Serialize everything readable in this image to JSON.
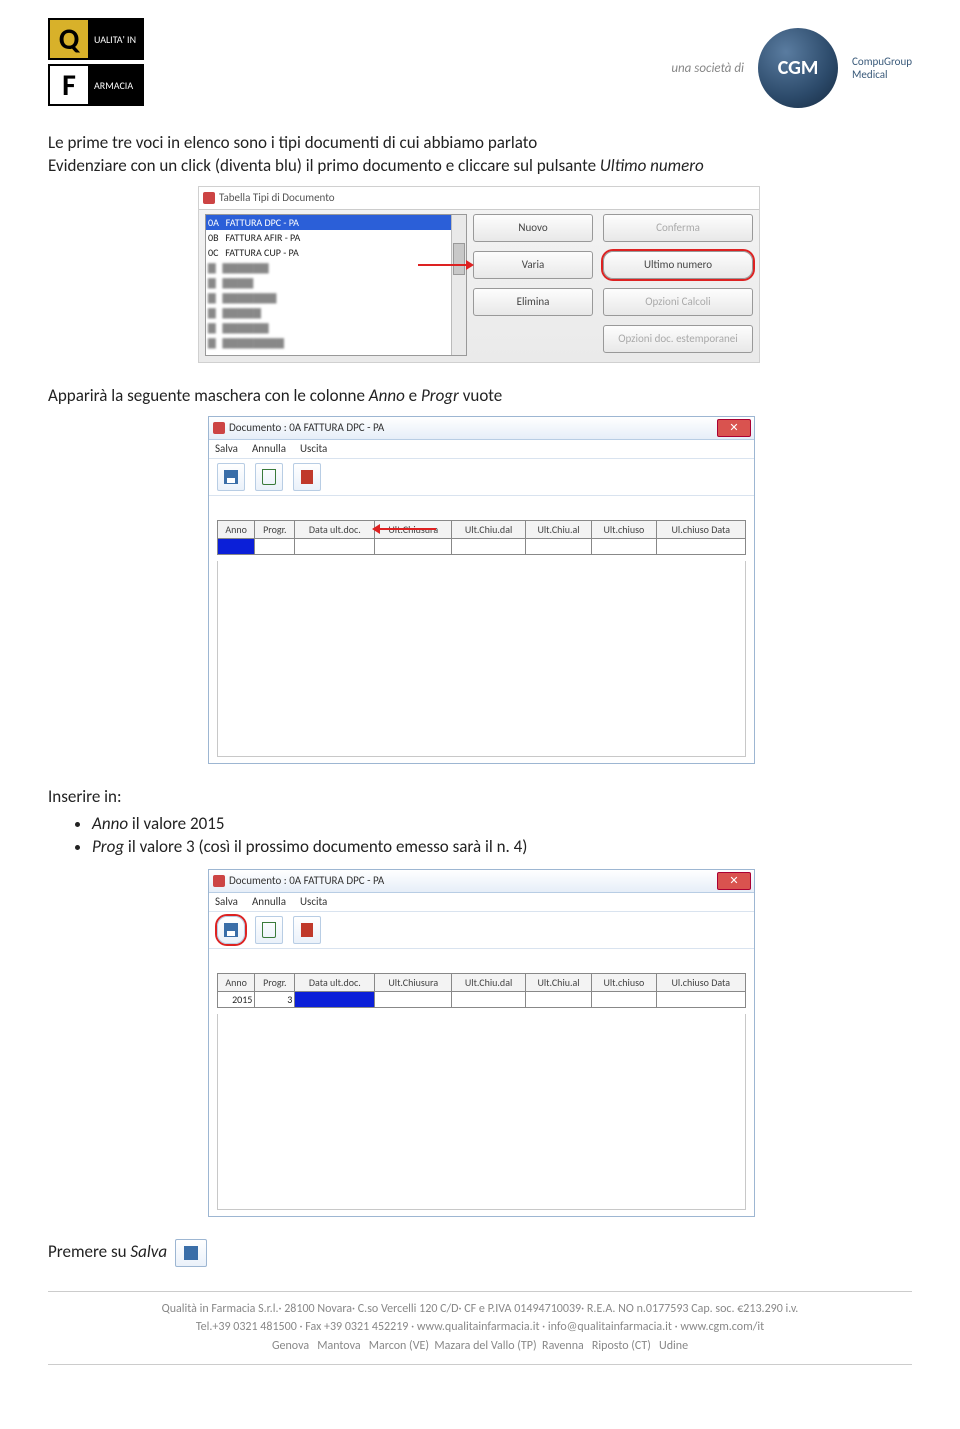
{
  "header": {
    "logo_line1": "UALITA' IN",
    "logo_line2": "ARMACIA",
    "una_societa": "una società di",
    "cgm": "CGM",
    "cgm_sub": "CompuGroup\nMedical"
  },
  "p1_a": "Le prime tre voci in elenco sono i tipi documenti di cui abbiamo parlato",
  "p1_b_pre": "Evidenziare con un click (diventa blu) il primo documento e cliccare sul pulsante ",
  "p1_b_i": "Ultimo numero",
  "shot1": {
    "title": "Tabella Tipi di Documento",
    "rows": [
      {
        "c": "0A",
        "d": "FATTURA DPC - PA"
      },
      {
        "c": "0B",
        "d": "FATTURA AFIR - PA"
      },
      {
        "c": "0C",
        "d": "FATTURA CUP - PA"
      }
    ],
    "btn_nuovo": "Nuovo",
    "btn_conferma": "Conferma",
    "btn_varia": "Varia",
    "btn_ultimo": "Ultimo numero",
    "btn_elimina": "Elimina",
    "btn_opzcalc": "Opzioni Calcoli",
    "btn_opzdoc": "Opzioni doc. estemporanei"
  },
  "p2_a": "Apparirà la seguente maschera con le colonne ",
  "p2_i1": "Anno",
  "p2_mid": " e ",
  "p2_i2": "Progr",
  "p2_end": " vuote",
  "shot2": {
    "title": "Documento : 0A FATTURA DPC - PA",
    "menu": [
      "Salva",
      "Annulla",
      "Uscita"
    ],
    "cols": [
      "Anno",
      "Progr.",
      "Data ult.doc.",
      "Ult.Chiusura",
      "Ult.Chiu.dal",
      "Ult.Chiu.al",
      "Ult.chiuso",
      "Ul.chiuso Data"
    ]
  },
  "p3": "Inserire in:",
  "li1_pre": "Anno",
  "li1_post": " il valore 2015",
  "li2_pre": "Prog",
  "li2_post": " il valore 3 (così il prossimo documento emesso sarà il n. 4)",
  "shot3": {
    "anno": "2015",
    "progr": "3"
  },
  "p4_pre": "Premere su ",
  "p4_i": "Salva",
  "footer": {
    "l1": "Qualità in Farmacia S.r.l.· 28100 Novara· C.so Vercelli 120 C/D· CF e P.IVA 01494710039· R.E.A. NO n.0177593 Cap. soc. €213.290 i.v.",
    "l2": "Tel.+39 0321 481500 · Fax +39 0321 452219 · www.qualitainfarmacia.it · info@qualitainfarmacia.it · www.cgm.com/it",
    "l3": "Genova   Mantova   Marcon (VE)  Mazara del Vallo (TP)  Ravenna   Riposto (CT)   Udine"
  }
}
